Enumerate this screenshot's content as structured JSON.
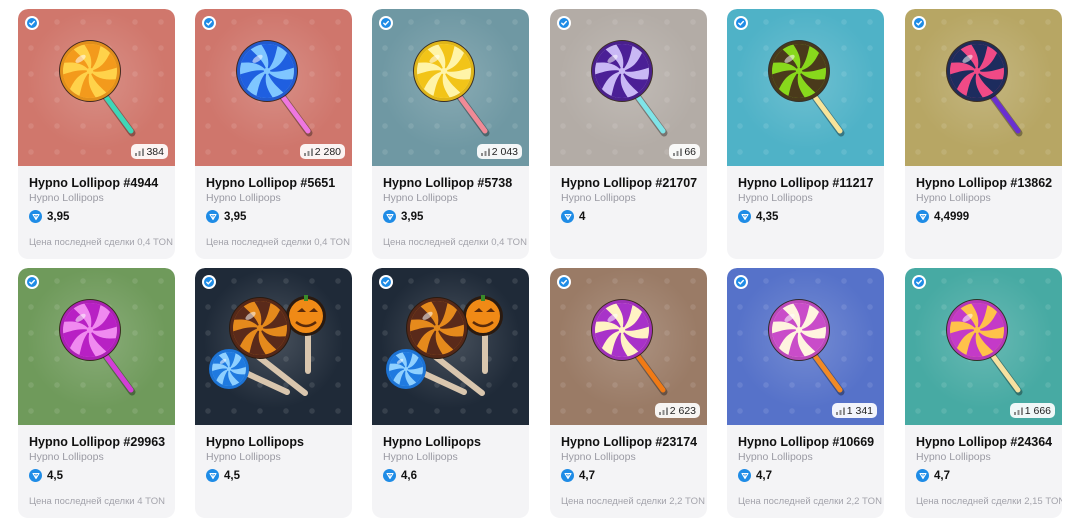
{
  "cards": [
    {
      "title": "Hypno Lollipop #4944",
      "collection": "Hypno Lollipops",
      "price": "3,95",
      "last_sale": "Цена последней сделки 0,4 TON",
      "count": "384",
      "bg": "#d0776c",
      "candy": [
        "#f39a1c",
        "#ffd24a"
      ],
      "stick": "#3fd6b7",
      "type": "lolli"
    },
    {
      "title": "Hypno Lollipop #5651",
      "collection": "Hypno Lollipops",
      "price": "3,95",
      "last_sale": "Цена последней сделки 0,4 TON",
      "count": "2 280",
      "bg": "#cf766c",
      "candy": [
        "#1f5fe0",
        "#7fc6ff"
      ],
      "stick": "#ee77e0",
      "type": "lolli"
    },
    {
      "title": "Hypno Lollipop #5738",
      "collection": "Hypno Lollipops",
      "price": "3,95",
      "last_sale": "Цена последней сделки 0,4 TON",
      "count": "2 043",
      "bg": "#6f98a3",
      "candy": [
        "#f2c418",
        "#fff4a8"
      ],
      "stick": "#f08a96",
      "type": "lolli"
    },
    {
      "title": "Hypno Lollipop #21707",
      "collection": "Hypno Lollipops",
      "price": "4",
      "last_sale": "",
      "count": "66",
      "bg": "#b3aca6",
      "candy": [
        "#4b1f96",
        "#c9b8f5"
      ],
      "stick": "#7fe4e8",
      "type": "lolli"
    },
    {
      "title": "Hypno Lollipop #11217",
      "collection": "Hypno Lollipops",
      "price": "4,35",
      "last_sale": "",
      "count": "",
      "bg": "#4fb2c7",
      "candy": [
        "#4a3a1b",
        "#88d81c"
      ],
      "stick": "#f7e49a",
      "type": "lolli"
    },
    {
      "title": "Hypno Lollipop #13862",
      "collection": "Hypno Lollipops",
      "price": "4,4999",
      "last_sale": "",
      "count": "",
      "bg": "#b7a664",
      "candy": [
        "#1d2c5e",
        "#f04a86"
      ],
      "stick": "#6a2fd0",
      "type": "lolli"
    },
    {
      "title": "Hypno Lollipop #29963",
      "collection": "Hypno Lollipops",
      "price": "4,5",
      "last_sale": "Цена последней сделки 4 TON",
      "count": "",
      "bg": "#6f9a5b",
      "candy": [
        "#b820c4",
        "#f08af0"
      ],
      "stick": "#d23fd6",
      "type": "lolli"
    },
    {
      "title": "Hypno Lollipops",
      "collection": "Hypno Lollipops",
      "price": "4,5",
      "last_sale": "",
      "count": "",
      "bg": "#1f2a38",
      "candy": [
        "#5a2a1a",
        "#e58a1c"
      ],
      "stick": "#d9c6ae",
      "type": "bundle"
    },
    {
      "title": "Hypno Lollipops",
      "collection": "Hypno Lollipops",
      "price": "4,6",
      "last_sale": "",
      "count": "",
      "bg": "#1f2a38",
      "candy": [
        "#5a2a1a",
        "#e58a1c"
      ],
      "stick": "#d9c6ae",
      "type": "bundle"
    },
    {
      "title": "Hypno Lollipop #23174",
      "collection": "Hypno Lollipops",
      "price": "4,7",
      "last_sale": "Цена последней сделки 2,2 TON",
      "count": "2 623",
      "bg": "#9a7b66",
      "candy": [
        "#a832c9",
        "#fff3c4"
      ],
      "stick": "#f07a16",
      "type": "lolli"
    },
    {
      "title": "Hypno Lollipop #10669",
      "collection": "Hypno Lollipops",
      "price": "4,7",
      "last_sale": "Цена последней сделки 2,2 TON",
      "count": "1 341",
      "bg": "#5672c9",
      "candy": [
        "#c94cc9",
        "#fff4df"
      ],
      "stick": "#f08a26",
      "type": "lolli"
    },
    {
      "title": "Hypno Lollipop #24364",
      "collection": "Hypno Lollipops",
      "price": "4,7",
      "last_sale": "Цена последней сделки 2,15 TON",
      "count": "1 666",
      "bg": "#47aaa3",
      "candy": [
        "#c43ac8",
        "#ffc24a"
      ],
      "stick": "#f6e1a0",
      "type": "lolli"
    }
  ]
}
